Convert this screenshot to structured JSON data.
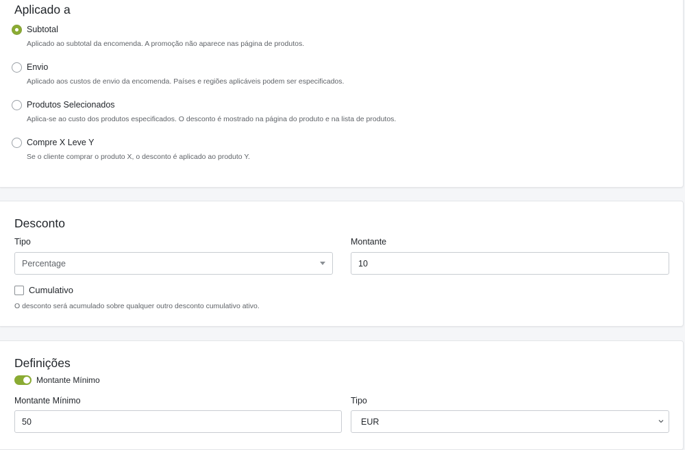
{
  "applied": {
    "title": "Aplicado a",
    "options": [
      {
        "label": "Subtotal",
        "desc": "Aplicado ao subtotal da encomenda. A promoção não aparece nas página de produtos.",
        "checked": true
      },
      {
        "label": "Envio",
        "desc": "Aplicado aos custos de envio da encomenda. Países e regiões aplicáveis podem ser especificados.",
        "checked": false
      },
      {
        "label": "Produtos Selecionados",
        "desc": "Aplica-se ao custo dos produtos especificados. O desconto é mostrado na página do produto e na lista de produtos.",
        "checked": false
      },
      {
        "label": "Compre X Leve Y",
        "desc": "Se o cliente comprar o produto X, o desconto é aplicado ao produto Y.",
        "checked": false
      }
    ]
  },
  "discount": {
    "title": "Desconto",
    "type_label": "Tipo",
    "type_value": "Percentage",
    "amount_label": "Montante",
    "amount_value": "10",
    "cumulative_label": "Cumulativo",
    "cumulative_checked": false,
    "cumulative_help": "O desconto será acumulado sobre qualquer outro desconto cumulativo ativo."
  },
  "settings": {
    "title": "Definições",
    "min_toggle_label": "Montante Mínimo",
    "min_toggle_on": true,
    "min_amount_label": "Montante Mínimo",
    "min_amount_value": "50",
    "currency_label": "Tipo",
    "currency_value": "EUR"
  },
  "colors": {
    "accent": "#8aab33",
    "border": "#c8ccd1",
    "muted_text": "#5f6368"
  }
}
